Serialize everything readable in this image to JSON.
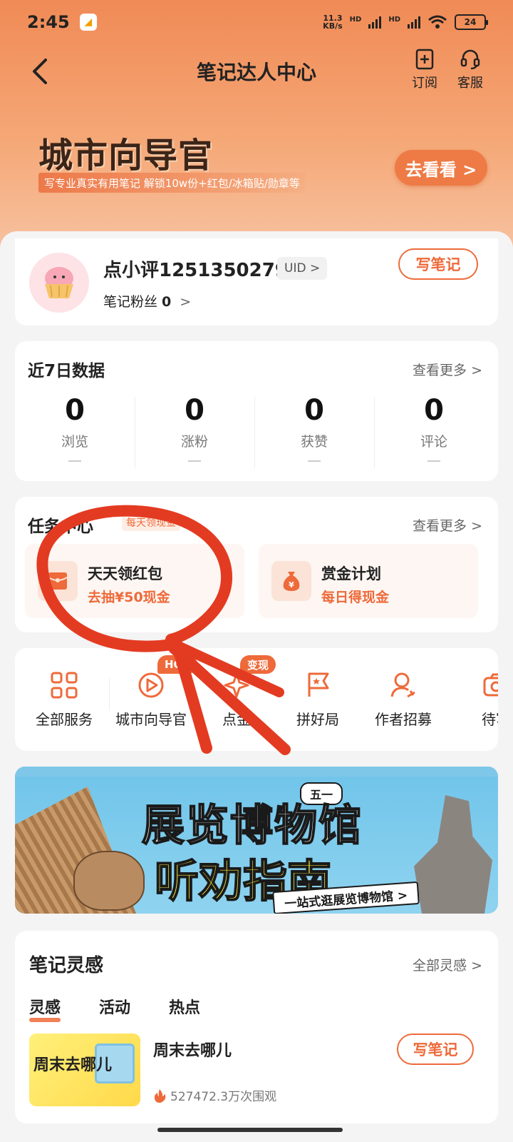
{
  "status_bar": {
    "time": "2:45",
    "net_speed_value": "11.3",
    "net_speed_unit": "KB/s",
    "signal1": "HD",
    "signal2": "HD",
    "battery": "24"
  },
  "nav": {
    "title": "笔记达人中心",
    "subscribe": "订阅",
    "service": "客服"
  },
  "banner": {
    "title": "城市向导官",
    "subtitle": "写专业真实有用笔记 解锁10w份+红包/冰箱贴/勋章等",
    "button": "去看看 >"
  },
  "profile": {
    "username": "点小评1251350279",
    "uid_tag": "UID >",
    "fans_label": "笔记粉丝",
    "fans_count": "0",
    "fans_arrow": ">",
    "write_button": "写笔记"
  },
  "stats": {
    "title": "近7日数据",
    "more": "查看更多 >",
    "items": [
      {
        "value": "0",
        "label": "浏览",
        "trend": "—"
      },
      {
        "value": "0",
        "label": "涨粉",
        "trend": "—"
      },
      {
        "value": "0",
        "label": "获赞",
        "trend": "—"
      },
      {
        "value": "0",
        "label": "评论",
        "trend": "—"
      }
    ]
  },
  "tasks": {
    "title": "任务中心",
    "tag": "每天领现金",
    "more": "查看更多 >",
    "items": [
      {
        "title": "天天领红包",
        "subtitle": "去抽¥50现金",
        "icon": "red-envelope-icon"
      },
      {
        "title": "赏金计划",
        "subtitle": "每日得现金",
        "icon": "money-bag-icon"
      }
    ]
  },
  "services": {
    "items": [
      {
        "label": "全部服务",
        "icon": "grid-icon",
        "badge": ""
      },
      {
        "label": "城市向导官",
        "icon": "compass-play-icon",
        "badge": "HOT"
      },
      {
        "label": "点金",
        "icon": "sparkle-icon",
        "badge": "变现"
      },
      {
        "label": "拼好局",
        "icon": "flag-icon",
        "badge": ""
      },
      {
        "label": "作者招募",
        "icon": "person-icon",
        "badge": ""
      },
      {
        "label": "待写",
        "icon": "camera-icon",
        "badge": ""
      }
    ]
  },
  "promo": {
    "title_line1": "展览博物馆",
    "title_line2": "听劝指南",
    "badge": "五一",
    "cta": "一站式逛展览博物馆 >"
  },
  "ideas": {
    "title": "笔记灵感",
    "more": "全部灵感 >",
    "tabs": [
      "灵感",
      "活动",
      "热点"
    ],
    "active_tab": "灵感",
    "item": {
      "thumb_text": "周末去哪儿",
      "title": "周末去哪儿",
      "views": "527472.3万次围观",
      "button": "写笔记"
    }
  },
  "colors": {
    "accent": "#ee6a3a",
    "header_gradient_top": "#f08a55",
    "annotation_red": "#e33b22"
  }
}
